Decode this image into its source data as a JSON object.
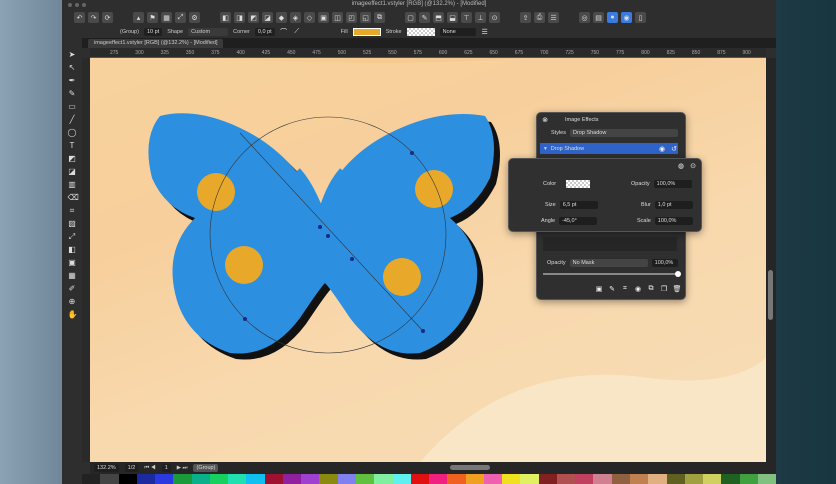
{
  "window": {
    "title": "imageeffect1.vstyler [RGB] (@132.2%) - [Modified]",
    "tab": "imageeffect1.vstyler [RGB] (@132.2%) - [Modified]"
  },
  "control_bar": {
    "selection": "(Group)",
    "stroke_width": "10 pt",
    "shape_label": "Shape",
    "shape_value": "Custom",
    "corner_label": "Corner",
    "corner_value": "0,0 pt",
    "fill_label": "Fill",
    "stroke_label": "Stroke",
    "stroke_value": "None",
    "fill_color": "#e8a82a"
  },
  "ruler": [
    "275",
    "300",
    "325",
    "350",
    "375",
    "400",
    "425",
    "450",
    "475",
    "500",
    "525",
    "550",
    "575",
    "600",
    "625",
    "650",
    "675",
    "700",
    "725",
    "750",
    "775",
    "800",
    "825",
    "850",
    "875",
    "900"
  ],
  "image_effects": {
    "title": "Image Effects",
    "styles_label": "Styles",
    "styles_value": "Drop Shadow",
    "effect_name": "Drop Shadow",
    "opacity_label": "Opacity",
    "mask_value": "No Mask",
    "opacity_value": "100,0%"
  },
  "shadow_popup": {
    "color_label": "Color",
    "opacity_label": "Opacity",
    "opacity_value": "100,0%",
    "size_label": "Size",
    "size_value": "6,5 pt",
    "blur_label": "Blur",
    "blur_value": "1,0 pt",
    "angle_label": "Angle",
    "angle_value": "-45,0°",
    "scale_label": "Scale",
    "scale_value": "100,0%"
  },
  "status": {
    "zoom": "132.2%",
    "page": "1/2",
    "layer_index": "1",
    "layer": "(Group)"
  },
  "colors": {
    "butterfly": "#2d8fe0",
    "spot": "#e8a82a",
    "accent": "#3b7be0"
  }
}
